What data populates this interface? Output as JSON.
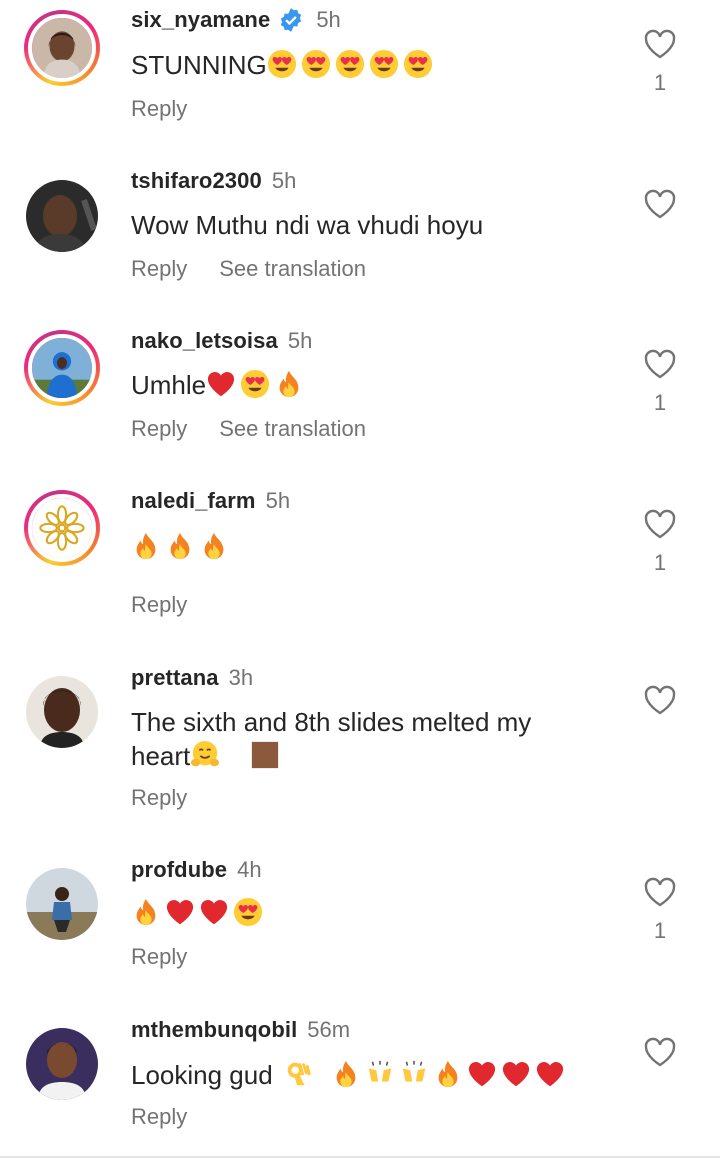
{
  "comments": [
    {
      "username": "six_nyamane",
      "verified": true,
      "time": "5h",
      "text": "STUNNING",
      "emojis": [
        "heart-eyes-emoji",
        "heart-eyes-emoji",
        "heart-eyes-emoji",
        "heart-eyes-emoji",
        "heart-eyes-emoji"
      ],
      "reply": "Reply",
      "likes": "1"
    },
    {
      "username": "tshifaro2300",
      "time": "5h",
      "text": "Wow Muthu ndi wa vhudi hoyu",
      "reply": "Reply",
      "translate": "See translation"
    },
    {
      "username": "nako_letsoisa",
      "time": "5h",
      "text": "Umhle",
      "emojis": [
        "red-heart-emoji",
        "heart-eyes-emoji",
        "fire-emoji"
      ],
      "reply": "Reply",
      "translate": "See translation",
      "likes": "1"
    },
    {
      "username": "naledi_farm",
      "time": "5h",
      "text": "",
      "emojis": [
        "fire-emoji",
        "fire-emoji",
        "fire-emoji"
      ],
      "reply": "Reply",
      "likes": "1"
    },
    {
      "username": "prettana",
      "time": "3h",
      "text_line1": "The sixth and 8th slides melted my",
      "text_line2": "heart",
      "emojis": [
        "hugging-face-emoji",
        "brown-square-emoji"
      ],
      "reply": "Reply"
    },
    {
      "username": "profdube",
      "time": "4h",
      "text": "",
      "emojis": [
        "fire-emoji",
        "red-heart-emoji",
        "red-heart-emoji",
        "heart-eyes-emoji"
      ],
      "reply": "Reply",
      "likes": "1"
    },
    {
      "username": "mthembunqobil",
      "time": "56m",
      "text": "Looking gud",
      "emojis": [
        "ok-hand-emoji",
        "fire-emoji",
        "raising-hands-emoji",
        "raising-hands-emoji",
        "fire-emoji",
        "red-heart-emoji",
        "red-heart-emoji",
        "red-heart-emoji"
      ],
      "reply": "Reply"
    }
  ],
  "colors": {
    "primary_text": "#262626",
    "secondary_text": "#737373",
    "verified_blue": "#3897f0",
    "heart_red": "#e0282e"
  }
}
